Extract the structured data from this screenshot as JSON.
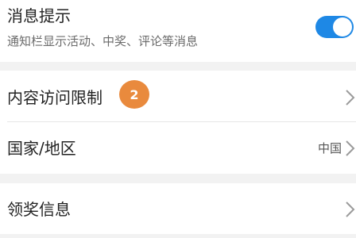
{
  "notification": {
    "title": "消息提示",
    "subtitle": "通知栏显示活动、中奖、评论等消息",
    "enabled": true
  },
  "content_restriction": {
    "label": "内容访问限制",
    "badge": "2"
  },
  "country_region": {
    "label": "国家/地区",
    "value": "中国"
  },
  "prize_info": {
    "label": "领奖信息"
  },
  "colors": {
    "toggle_on": "#1e88e5",
    "badge": "#e98a3d",
    "background": "#f2f2f2"
  },
  "icons": {
    "chevron": "chevron-right-icon"
  }
}
